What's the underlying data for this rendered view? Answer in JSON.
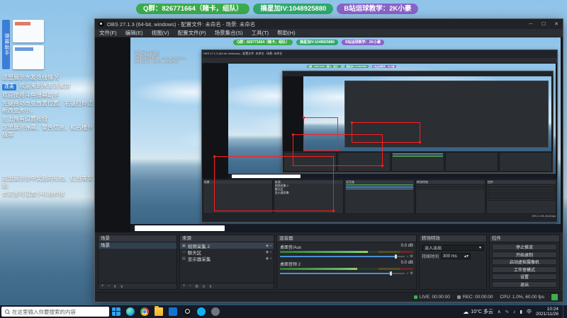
{
  "banner": {
    "pills": [
      {
        "text": "Q群：826771664（赌卡，组队）",
        "color": "#3cab4e"
      },
      {
        "text": "摘星加IV:1048925880",
        "color": "#2fa86d"
      },
      {
        "text": "B站运球教学：2K小豪",
        "color": "#8a63c9"
      }
    ]
  },
  "overlay": {
    "helper_title": "弹幕助手",
    "line_links": "这里展示水友连线情况",
    "chip": "连麦",
    "chip_text": "欢迎来到水友连麦房",
    "tips": [
      "欢迎使用斗鱼弹幕助手",
      "左键拖动改变放置位置，右键拉伸边框改变大小，",
      "左上角有设置按钮",
      "这里展示弹幕，警告信息，和占槽升级等"
    ],
    "gift_tips": [
      "这里展示你中奖励的礼物、红包等奖励",
      "点这里可设置小礼物秒擦"
    ]
  },
  "obs": {
    "title": "OBS 27.1.3 (64-bit, windows) - 配置文件: 未命名 - 场景: 未命名",
    "window_buttons": {
      "min": "─",
      "max": "☐",
      "close": "✕"
    },
    "menu": [
      "文件(F)",
      "编辑(E)",
      "视图(V)",
      "配置文件(P)",
      "场景集合(S)",
      "工具(T)",
      "帮助(H)"
    ],
    "scenes": {
      "title": "场景",
      "items": [
        "场景"
      ]
    },
    "sources": {
      "title": "来源",
      "items": [
        "视频采集 2",
        "聊天区",
        "显示器采集"
      ]
    },
    "mixer": {
      "title": "混音器",
      "channels": [
        {
          "name": "桌面音/Aux",
          "db": "0.0 dB"
        },
        {
          "name": "桌面音频 2",
          "db": "0.0 dB"
        }
      ]
    },
    "transitions": {
      "title": "转场特效",
      "current": "淡入淡出",
      "duration_label": "持续时间",
      "duration": "300 ms"
    },
    "controls": {
      "title": "控件",
      "buttons": [
        "停止推流",
        "开始录制",
        "启动虚拟摄像机",
        "工作室模式",
        "设置",
        "退出"
      ]
    },
    "status": {
      "live": "LIVE: 00:00:00",
      "rec": "REC: 00:00:00",
      "cpu": "CPU: 1.0%, 60.00 fps"
    }
  },
  "taskbar": {
    "search_placeholder": "在这里输入你要搜索的内容",
    "weather": "10°C 多云",
    "lang": "中",
    "time": "10:24",
    "date": "2021/11/26"
  }
}
